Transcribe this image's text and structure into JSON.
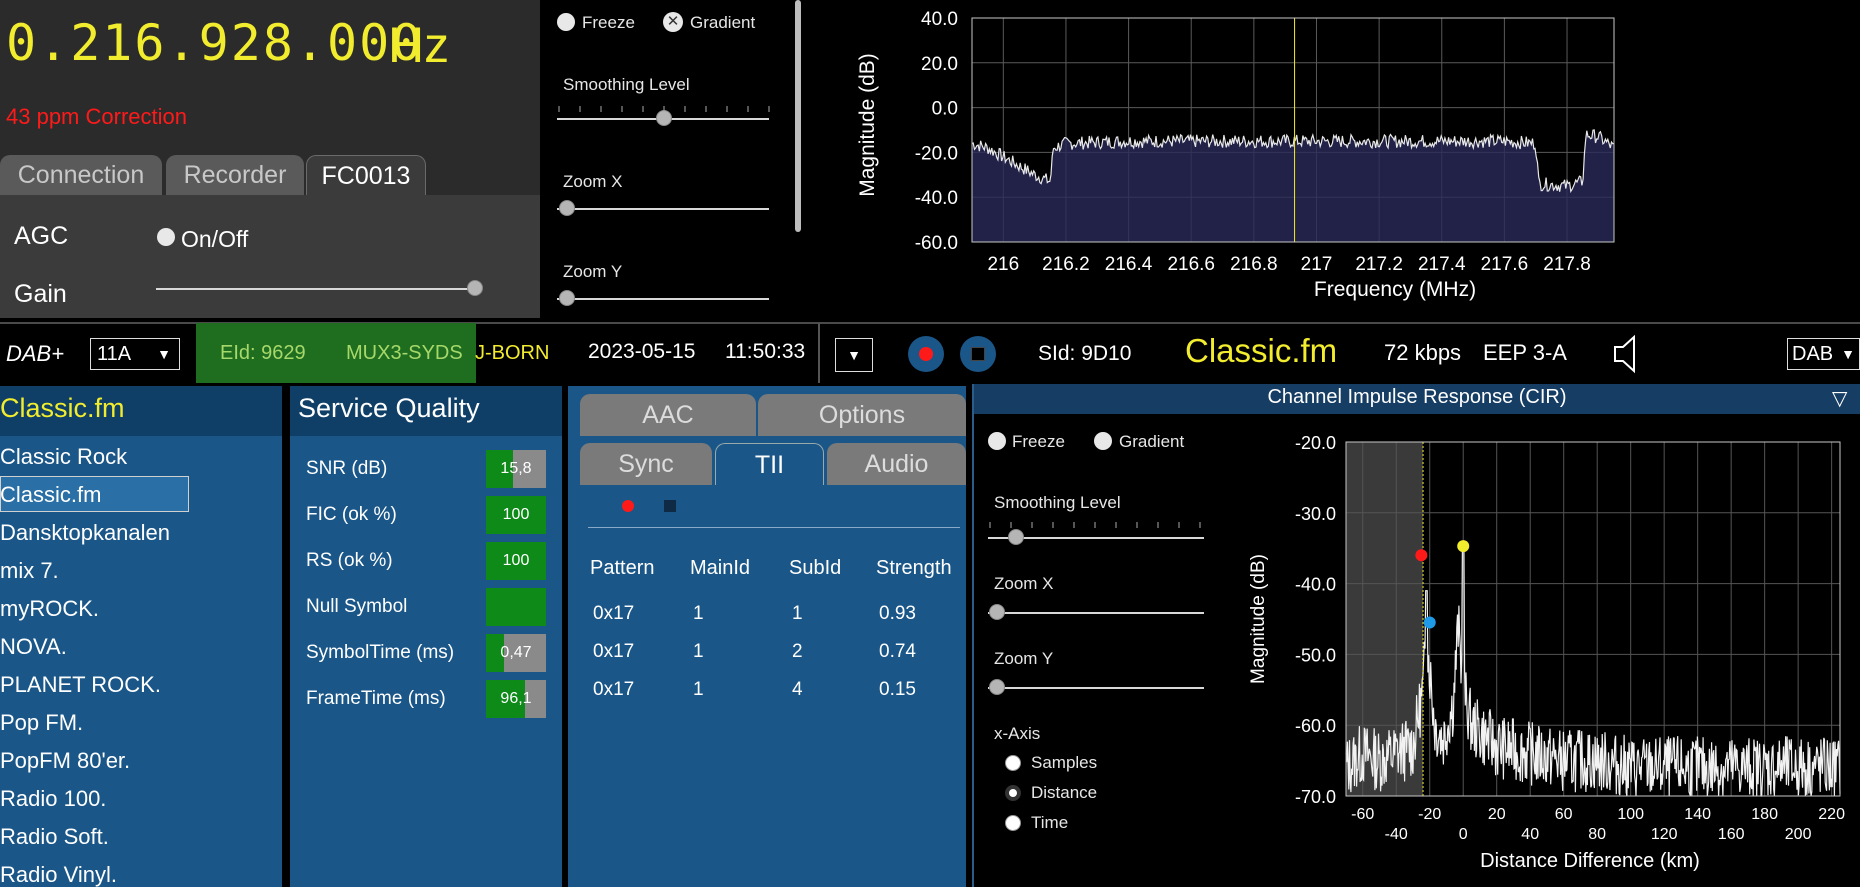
{
  "frequency": {
    "value": "0.216.928.000",
    "unit": "Hz",
    "ppm": "43 ppm Correction"
  },
  "top_tabs": [
    "Connection",
    "Recorder",
    "FC0013"
  ],
  "device": {
    "agc_label": "AGC",
    "agc_toggle": "On/Off",
    "gain_label": "Gain"
  },
  "spectrum_controls": {
    "freeze": "Freeze",
    "gradient": "Gradient",
    "smoothing": "Smoothing Level",
    "zoom_x": "Zoom X",
    "zoom_y": "Zoom Y"
  },
  "status": {
    "mode": "DAB+",
    "channel": "11A",
    "eid": "EId: 9629",
    "ensemble_a": "MUX3-SYDS",
    "ensemble_b": "J-BORN",
    "date": "2023-05-15",
    "time": "11:50:33",
    "sid": "SId: 9D10",
    "station": "Classic.fm",
    "bitrate": "72 kbps",
    "protection": "EEP 3-A",
    "band": "DAB"
  },
  "service_list": {
    "title": "Classic.fm",
    "items": [
      "Classic Rock",
      "Classic.fm",
      "Dansktopkanalen",
      "mix 7.",
      "myROCK.",
      "NOVA.",
      "PLANET ROCK.",
      "Pop FM.",
      "PopFM 80'er.",
      "Radio 100.",
      "Radio Soft.",
      "Radio Vinyl."
    ],
    "selected_index": 1
  },
  "service_quality": {
    "title": "Service Quality",
    "rows": [
      {
        "label": "SNR (dB)",
        "value": "15,8",
        "fill": 0.45
      },
      {
        "label": "FIC (ok %)",
        "value": "100",
        "fill": 1.0
      },
      {
        "label": "RS (ok %)",
        "value": "100",
        "fill": 1.0
      },
      {
        "label": "Null Symbol",
        "value": "",
        "fill": 1.0
      },
      {
        "label": "SymbolTime (ms)",
        "value": "0,47",
        "fill": 0.3
      },
      {
        "label": "FrameTime (ms)",
        "value": "96,1",
        "fill": 0.65
      }
    ]
  },
  "tii": {
    "tabs_row1": [
      "AAC",
      "Options"
    ],
    "tabs_row2": [
      "Sync",
      "TII",
      "Audio"
    ],
    "headers": [
      "Pattern",
      "MainId",
      "SubId",
      "Strength"
    ],
    "rows": [
      [
        "0x17",
        "1",
        "1",
        "0.93"
      ],
      [
        "0x17",
        "1",
        "2",
        "0.74"
      ],
      [
        "0x17",
        "1",
        "4",
        "0.15"
      ]
    ]
  },
  "cir": {
    "title": "Channel Impulse Response (CIR)",
    "freeze": "Freeze",
    "gradient": "Gradient",
    "smoothing": "Smoothing Level",
    "zoom_x": "Zoom X",
    "zoom_y": "Zoom Y",
    "x_axis_title": "x-Axis",
    "x_axis_options": [
      "Samples",
      "Distance",
      "Time"
    ],
    "x_axis_selected": "Distance"
  },
  "colors": {
    "accent_yellow": "#f2ec2e",
    "panel_blue": "#1a5687",
    "dark_blue": "#0f3f66",
    "green": "#0e8a18"
  },
  "chart_data": [
    {
      "type": "area",
      "title": "",
      "xlabel": "Frequency (MHz)",
      "ylabel": "Magnitude (dB)",
      "xlim": [
        215.9,
        217.95
      ],
      "ylim": [
        -60,
        40
      ],
      "x_ticks": [
        "216",
        "216.2",
        "216.4",
        "216.6",
        "216.8",
        "217",
        "217.2",
        "217.4",
        "217.6",
        "217.8"
      ],
      "y_ticks": [
        "40.0",
        "20.0",
        "0.0",
        "-20.0",
        "-40.0",
        "-60.0"
      ],
      "x": [
        215.9,
        215.95,
        216.0,
        216.05,
        216.1,
        216.15,
        216.16,
        216.2,
        216.4,
        216.6,
        216.8,
        217.0,
        217.2,
        217.4,
        217.6,
        217.7,
        217.71,
        217.8,
        217.85,
        217.86,
        217.9,
        217.95
      ],
      "values": [
        -16,
        -18,
        -22,
        -26,
        -30,
        -33,
        -18,
        -16,
        -15,
        -15,
        -15,
        -15,
        -15,
        -15,
        -15,
        -16,
        -34,
        -35,
        -33,
        -12,
        -13,
        -18
      ],
      "marker_x": 216.93,
      "grid": true
    },
    {
      "type": "line",
      "title": "",
      "xlabel": "Distance Difference (km)",
      "ylabel": "Magnitude (dB)",
      "xlim": [
        -70,
        225
      ],
      "ylim": [
        -70,
        -20
      ],
      "x_ticks_top": [
        "-60",
        "-20",
        "20",
        "60",
        "100",
        "140",
        "180",
        "220"
      ],
      "x_ticks_bottom": [
        "-40",
        "0",
        "40",
        "80",
        "120",
        "160",
        "200"
      ],
      "y_ticks": [
        "-20.0",
        "-30.0",
        "-40.0",
        "-50.0",
        "-60.0",
        "-70.0"
      ],
      "x": [
        -70,
        -60,
        -50,
        -40,
        -30,
        -24,
        -22,
        -20,
        -17,
        -12,
        -6,
        -3,
        0,
        5,
        10,
        20,
        40,
        60,
        80,
        100,
        140,
        180,
        220
      ],
      "values": [
        -66,
        -64,
        -65,
        -64,
        -63,
        -55,
        -48,
        -52,
        -60,
        -62,
        -57,
        -46,
        -55,
        -60,
        -61,
        -63,
        -64,
        -65,
        -65,
        -66,
        -66,
        -66,
        -66
      ],
      "markers": [
        {
          "x": -25,
          "y": -36,
          "color": "#ff1a1a"
        },
        {
          "x": -20,
          "y": -45.5,
          "color": "#1e9ae6"
        },
        {
          "x": 0,
          "y": -34.7,
          "color": "#f2ec2e"
        }
      ],
      "grid": true
    }
  ]
}
